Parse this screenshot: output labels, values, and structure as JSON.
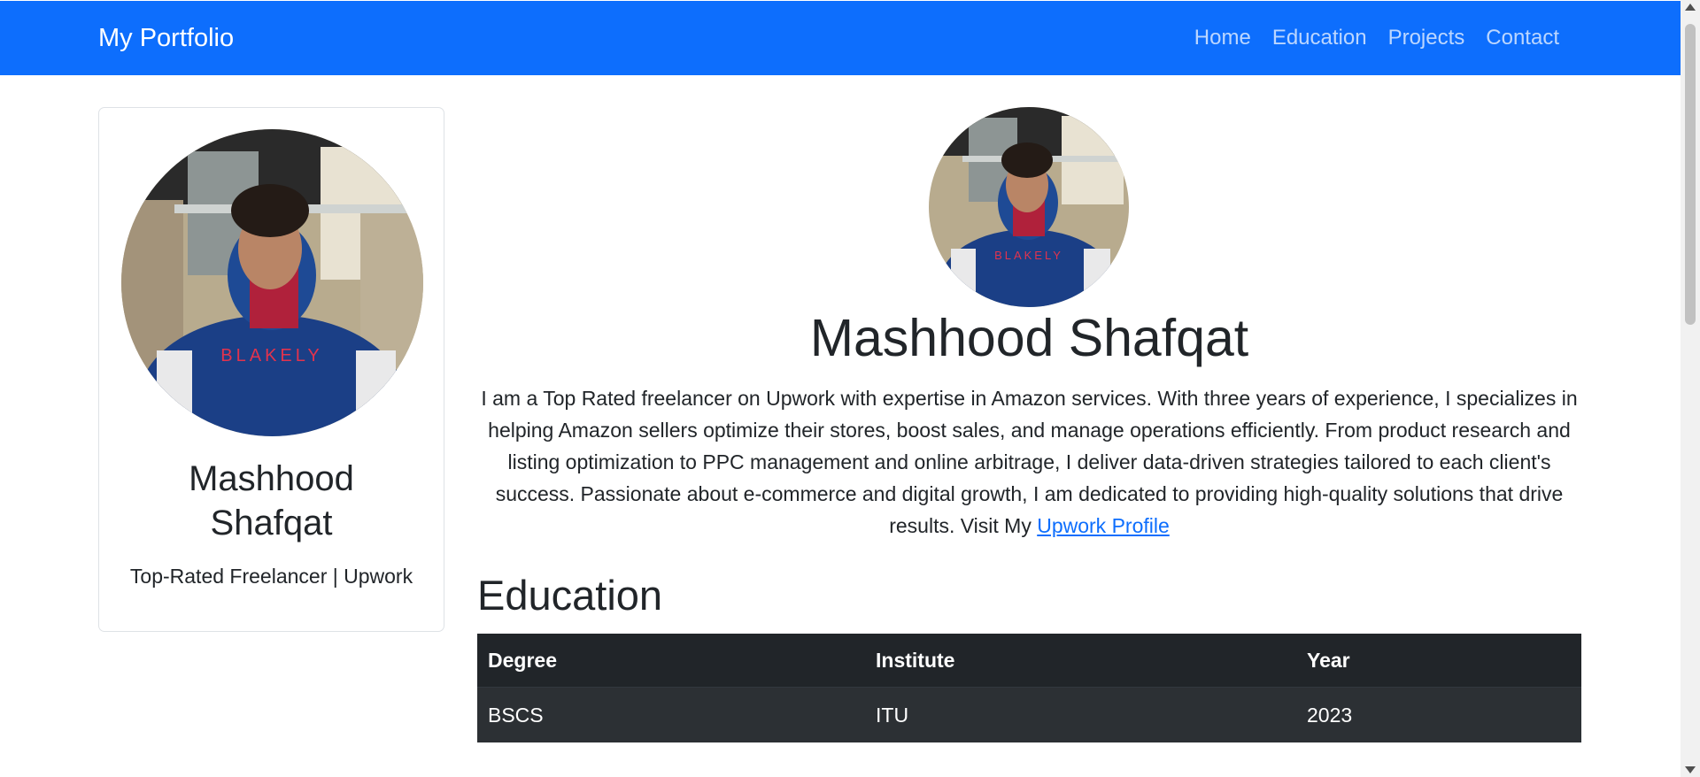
{
  "navbar": {
    "brand": "My Portfolio",
    "links": [
      {
        "label": "Home"
      },
      {
        "label": "Education"
      },
      {
        "label": "Projects"
      },
      {
        "label": "Contact"
      }
    ],
    "background_color": "#0d6efd"
  },
  "sidebar": {
    "name": "Mashhood Shafqat",
    "subtitle": "Top-Rated Freelancer | Upwork",
    "avatar_icon": "profile-photo"
  },
  "main": {
    "name": "Mashhood Shafqat",
    "bio_text": "I am a Top Rated freelancer on Upwork with expertise in Amazon services. With three years of experience, I specializes in helping Amazon sellers optimize their stores, boost sales, and manage operations efficiently. From product research and listing optimization to PPC management and online arbitrage, I deliver data-driven strategies tailored to each client's success. Passionate about e-commerce and digital growth, I am dedicated to providing high-quality solutions that drive results. Visit My ",
    "bio_link": "Upwork Profile",
    "link_color": "#0d6efd"
  },
  "education": {
    "heading": "Education",
    "columns": [
      "Degree",
      "Institute",
      "Year"
    ],
    "rows": [
      [
        "BSCS",
        "ITU",
        "2023"
      ]
    ]
  }
}
